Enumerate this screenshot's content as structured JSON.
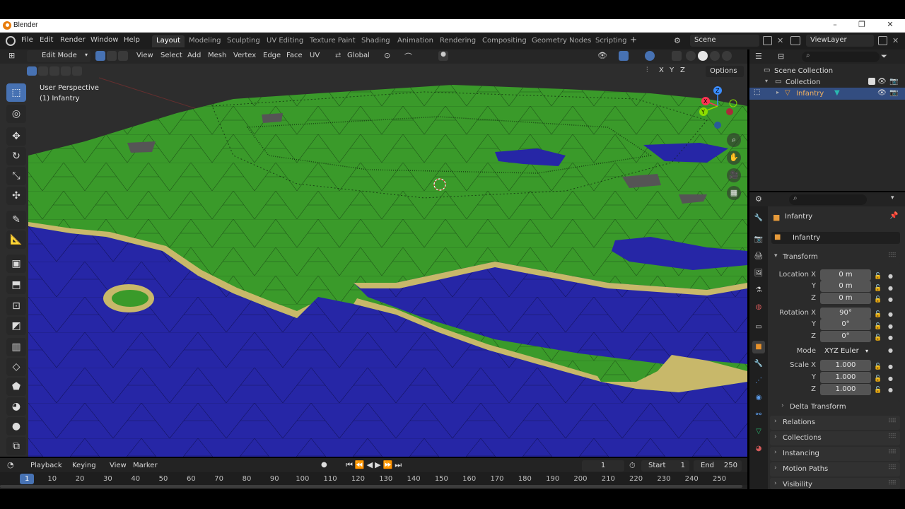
{
  "window": {
    "title": "Blender"
  },
  "menu": {
    "file": "File",
    "edit": "Edit",
    "render": "Render",
    "window": "Window",
    "help": "Help"
  },
  "workspaces": [
    "Layout",
    "Modeling",
    "Sculpting",
    "UV Editing",
    "Texture Paint",
    "Shading",
    "Animation",
    "Rendering",
    "Compositing",
    "Geometry Nodes",
    "Scripting"
  ],
  "scene": {
    "name": "Scene",
    "view_layer": "ViewLayer"
  },
  "viewport": {
    "mode": "Edit Mode",
    "menus": [
      "View",
      "Select",
      "Add",
      "Mesh",
      "Vertex",
      "Edge",
      "Face",
      "UV"
    ],
    "orientation": "Global",
    "options_label": "Options",
    "axis_x": "X",
    "axis_y": "Y",
    "axis_z": "Z",
    "overlay_line1": "User Perspective",
    "overlay_line2": "(1) Infantry",
    "colors": {
      "land": "#3a9a2a",
      "water": "#2626a6",
      "sand": "#c8b86a",
      "edge": "#111111"
    }
  },
  "outliner": {
    "scene_collection": "Scene Collection",
    "collection": "Collection",
    "object": "Infantry"
  },
  "properties": {
    "object_name": "Infantry",
    "data_name": "Infantry",
    "transform_label": "Transform",
    "location_x_label": "Location X",
    "location_x": "0 m",
    "location_y_label": "Y",
    "location_y": "0 m",
    "location_z_label": "Z",
    "location_z": "0 m",
    "rotation_x_label": "Rotation X",
    "rotation_x": "90°",
    "rotation_y_label": "Y",
    "rotation_y": "0°",
    "rotation_z_label": "Z",
    "rotation_z": "0°",
    "mode_label": "Mode",
    "mode_value": "XYZ Euler",
    "scale_x_label": "Scale X",
    "scale_x": "1.000",
    "scale_y_label": "Y",
    "scale_y": "1.000",
    "scale_z_label": "Z",
    "scale_z": "1.000",
    "delta_transform": "Delta Transform",
    "relations": "Relations",
    "collections": "Collections",
    "instancing": "Instancing",
    "motion_paths": "Motion Paths",
    "visibility": "Visibility"
  },
  "timeline": {
    "playback": "Playback",
    "keying": "Keying",
    "view": "View",
    "marker": "Marker",
    "current_frame": "1",
    "start_label": "Start",
    "start": "1",
    "end_label": "End",
    "end": "250",
    "ticks": [
      "1",
      "10",
      "20",
      "30",
      "40",
      "50",
      "60",
      "70",
      "80",
      "90",
      "100",
      "110",
      "120",
      "130",
      "140",
      "150",
      "160",
      "170",
      "180",
      "190",
      "200",
      "210",
      "220",
      "230",
      "240",
      "250"
    ]
  }
}
